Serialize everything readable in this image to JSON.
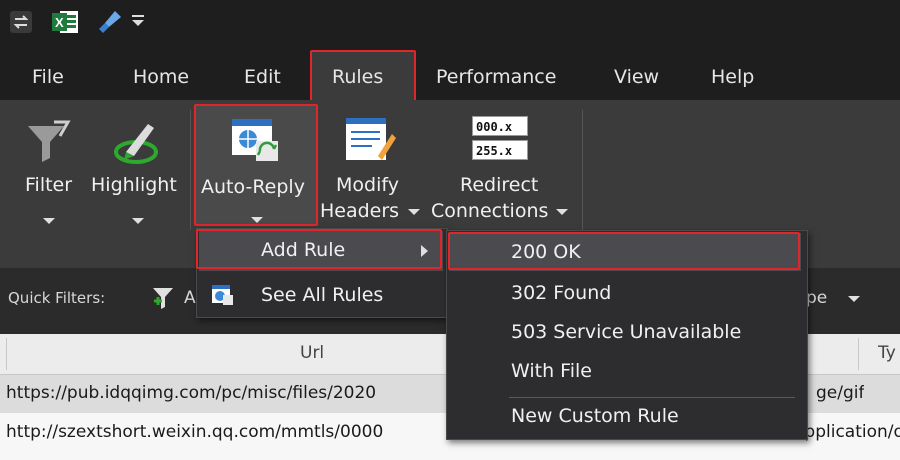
{
  "menu_tabs": [
    "File",
    "Home",
    "Edit",
    "Rules",
    "Performance",
    "View",
    "Help"
  ],
  "ribbon": {
    "filter": "Filter",
    "highlight": "Highlight",
    "auto_reply": "Auto-Reply",
    "modify_headers_1": "Modify",
    "modify_headers_2": "Headers",
    "redirect_1": "Redirect",
    "redirect_2": "Connections",
    "redirect_icon_text_1": "000.x",
    "redirect_icon_text_2": "255.x"
  },
  "quick_filters": {
    "label": "Quick Filters:",
    "partial_label": "A",
    "right_partial": "pe"
  },
  "grid": {
    "columns": [
      "Url",
      "Ty"
    ],
    "rows": [
      {
        "url": "https://pub.idqqimg.com/pc/misc/files/2020",
        "type": "ge/gif"
      },
      {
        "url": "http://szextshort.weixin.qq.com/mmtls/0000",
        "type": "application/o"
      }
    ]
  },
  "autoreply_menu": {
    "items": [
      "Add Rule",
      "See All Rules"
    ]
  },
  "submenu": {
    "items": [
      "200 OK",
      "302 Found",
      "503 Service Unavailable",
      "With File",
      "New Custom Rule"
    ]
  },
  "colors": {
    "highlight_red": "#e0262a",
    "ribbon_bg": "#3b3b3b",
    "menu_bg": "#2d2d30"
  }
}
